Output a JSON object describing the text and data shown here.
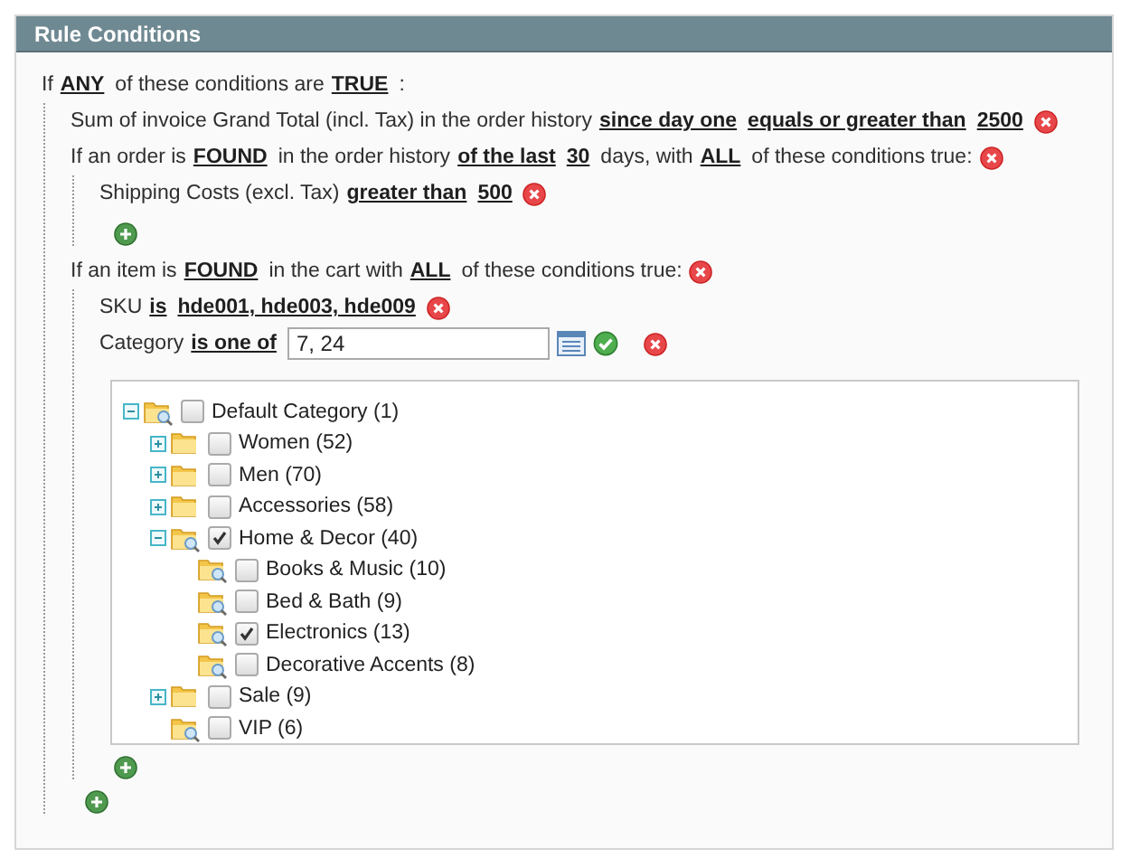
{
  "header": {
    "title": "Rule Conditions"
  },
  "conditions": {
    "parts": [
      {
        "kind": "text",
        "text": "If"
      },
      {
        "kind": "value",
        "text": "ANY"
      },
      {
        "kind": "text",
        "text": "of these conditions are"
      },
      {
        "kind": "value",
        "text": "TRUE"
      },
      {
        "kind": "text",
        "text": ":"
      }
    ],
    "can_add": true,
    "children": [
      {
        "parts": [
          {
            "kind": "text",
            "text": "Sum of invoice Grand Total (incl. Tax) in the order history"
          },
          {
            "kind": "value",
            "text": "since day one"
          },
          {
            "kind": "value",
            "text": "equals or greater than"
          },
          {
            "kind": "value",
            "text": "2500"
          }
        ],
        "removable": true
      },
      {
        "parts": [
          {
            "kind": "text",
            "text": "If an order is"
          },
          {
            "kind": "value",
            "text": "FOUND"
          },
          {
            "kind": "text",
            "text": "in the order history"
          },
          {
            "kind": "value",
            "text": "of the last"
          },
          {
            "kind": "value",
            "text": "30"
          },
          {
            "kind": "text",
            "text": "days, with"
          },
          {
            "kind": "value",
            "text": "ALL"
          },
          {
            "kind": "text",
            "text": "of these conditions true:"
          }
        ],
        "removable": true,
        "can_add": true,
        "children": [
          {
            "parts": [
              {
                "kind": "text",
                "text": "Shipping Costs (excl. Tax)"
              },
              {
                "kind": "value",
                "text": "greater than"
              },
              {
                "kind": "value",
                "text": "500"
              }
            ],
            "removable": true
          }
        ]
      },
      {
        "parts": [
          {
            "kind": "text",
            "text": "If an item is"
          },
          {
            "kind": "value",
            "text": "FOUND"
          },
          {
            "kind": "text",
            "text": "in the cart with"
          },
          {
            "kind": "value",
            "text": "ALL"
          },
          {
            "kind": "text",
            "text": "of these conditions true:"
          }
        ],
        "removable": true,
        "can_add": true,
        "children": [
          {
            "parts": [
              {
                "kind": "text",
                "text": "SKU"
              },
              {
                "kind": "value",
                "text": "is"
              },
              {
                "kind": "value",
                "text": "hde001, hde003, hde009"
              }
            ],
            "removable": true
          },
          {
            "parts": [
              {
                "kind": "text",
                "text": "Category"
              },
              {
                "kind": "value",
                "text": "is one of"
              },
              {
                "kind": "input",
                "value": "7, 24"
              }
            ],
            "removable": true,
            "chooser_open": true,
            "tree": [
              {
                "label": "Default Category (1)",
                "checked": false,
                "expanded": true,
                "children": [
                  {
                    "label": "Women (52)",
                    "checked": false,
                    "expanded": false
                  },
                  {
                    "label": "Men (70)",
                    "checked": false,
                    "expanded": false
                  },
                  {
                    "label": "Accessories (58)",
                    "checked": false,
                    "expanded": false
                  },
                  {
                    "label": "Home & Decor (40)",
                    "checked": true,
                    "expanded": true,
                    "children": [
                      {
                        "label": "Books & Music (10)",
                        "checked": false
                      },
                      {
                        "label": "Bed & Bath (9)",
                        "checked": false
                      },
                      {
                        "label": "Electronics (13)",
                        "checked": true
                      },
                      {
                        "label": "Decorative Accents (8)",
                        "checked": false
                      }
                    ]
                  },
                  {
                    "label": "Sale (9)",
                    "checked": false,
                    "expanded": false
                  },
                  {
                    "label": "VIP (6)",
                    "checked": false
                  }
                ]
              }
            ]
          }
        ]
      }
    ]
  }
}
